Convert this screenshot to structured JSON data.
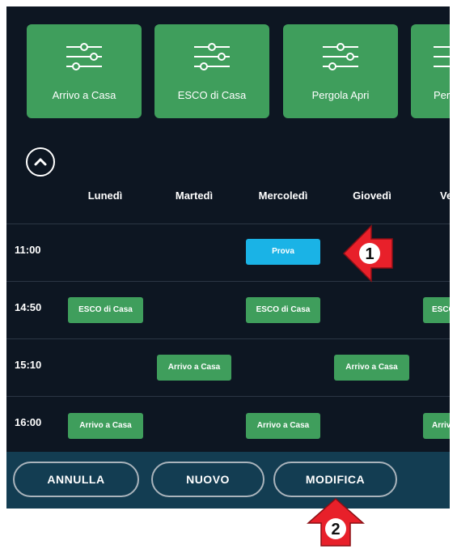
{
  "tiles": [
    {
      "label": "Arrivo a Casa"
    },
    {
      "label": "ESCO di Casa"
    },
    {
      "label": "Pergola Apri"
    },
    {
      "label": "Perg"
    }
  ],
  "collapse_icon": "chevron-up-icon",
  "days": [
    "Lunedì",
    "Martedì",
    "Mercoledì",
    "Giovedì",
    "Ve"
  ],
  "schedule": [
    {
      "time": "11:00",
      "events": [
        "Prova"
      ]
    },
    {
      "time": "14:50",
      "events": [
        "ESCO di Casa",
        "ESCO di Casa",
        "ESCO"
      ]
    },
    {
      "time": "15:10",
      "events": [
        "Arrivo a Casa",
        "Arrivo a Casa"
      ]
    },
    {
      "time": "16:00",
      "events": [
        "Arrivo a Casa",
        "Arrivo a Casa",
        "Arrivo"
      ]
    }
  ],
  "buttons": {
    "cancel": "ANNULLA",
    "new": "NUOVO",
    "edit": "MODIFICA"
  },
  "callouts": [
    "1",
    "2"
  ],
  "colors": {
    "background": "#0d1622",
    "tile": "#3f9e5c",
    "event_green": "#3f9e5c",
    "event_blue": "#1ab3e6",
    "bottom_bar": "#133d52",
    "callout": "#e8202a"
  }
}
